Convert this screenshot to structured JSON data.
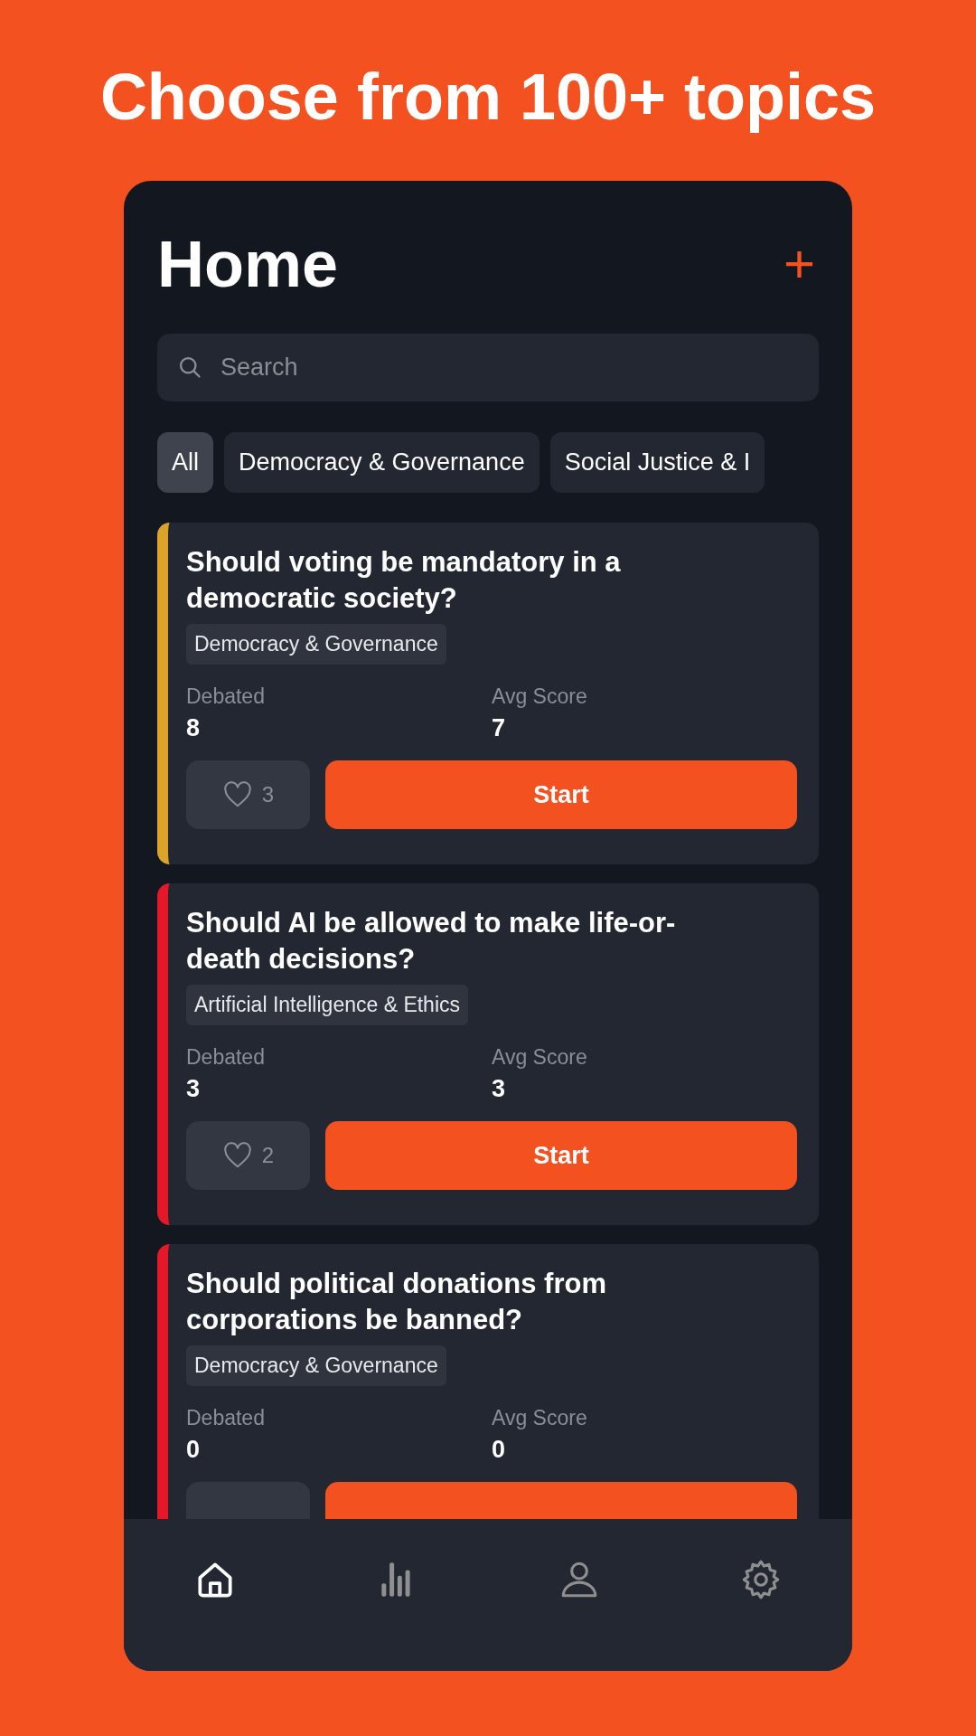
{
  "headline": "Choose from 100+ topics",
  "screen": {
    "title": "Home",
    "add_button": "+"
  },
  "search": {
    "placeholder": "Search"
  },
  "chips": [
    {
      "label": "All",
      "selected": true
    },
    {
      "label": "Democracy & Governance",
      "selected": false
    },
    {
      "label": "Social Justice & I",
      "selected": false
    }
  ],
  "cards": [
    {
      "title": "Should voting be mandatory in a democratic society?",
      "tag": "Democracy & Governance",
      "color": "#dba32a",
      "debated_label": "Debated",
      "debated": "8",
      "score_label": "Avg Score",
      "score": "7",
      "likes": "3",
      "button": "Start"
    },
    {
      "title": "Should AI be allowed to make life-or-death decisions?",
      "tag": "Artificial Intelligence & Ethics",
      "color": "#e5182a",
      "debated_label": "Debated",
      "debated": "3",
      "score_label": "Avg Score",
      "score": "3",
      "likes": "2",
      "button": "Start"
    },
    {
      "title": "Should political donations from corporations be banned?",
      "tag": "Democracy & Governance",
      "color": "#e5182a",
      "debated_label": "Debated",
      "debated": "0",
      "score_label": "Avg Score",
      "score": "0"
    }
  ],
  "nav": [
    {
      "kind": "home",
      "selected": true
    },
    {
      "kind": "stats",
      "selected": false
    },
    {
      "kind": "profile",
      "selected": false
    },
    {
      "kind": "settings",
      "selected": false
    }
  ]
}
